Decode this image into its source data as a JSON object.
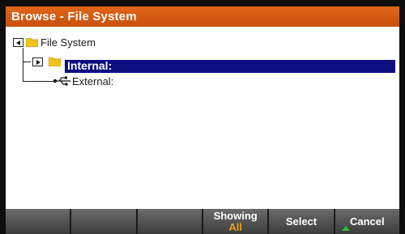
{
  "window": {
    "title": "Browse - File System"
  },
  "tree": {
    "root": {
      "label": "File System",
      "icon": "folder-icon",
      "expander": "collapse-arrow-icon"
    },
    "items": [
      {
        "label": "Internal:",
        "icon": "folder-icon",
        "expander": "expand-arrow-icon",
        "selected": true
      },
      {
        "label": "External:",
        "icon": "usb-icon",
        "selected": false
      }
    ]
  },
  "softkeys": [
    {
      "label": ""
    },
    {
      "label": ""
    },
    {
      "label": ""
    },
    {
      "label": "Showing",
      "sub": "All"
    },
    {
      "label": "Select"
    },
    {
      "label": "Cancel"
    }
  ],
  "colors": {
    "titlebar": "#d25a12",
    "selection": "#0d0d80",
    "softkey_sub": "#f0a020",
    "folder": "#f3c41a"
  }
}
